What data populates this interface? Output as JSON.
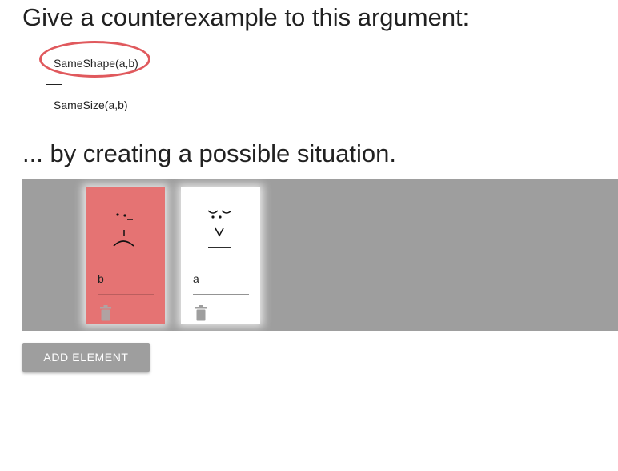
{
  "instructions": {
    "title": "Give a counterexample to this argument:",
    "subtitle": "... by creating a possible situation."
  },
  "argument": {
    "premise": "SameShape(a,b)",
    "conclusion": "SameSize(a,b)",
    "highlighted": "premise",
    "highlight_color": "#e0595d"
  },
  "world": {
    "background": "#9e9e9e",
    "elements": [
      {
        "name": "b",
        "face": "sad",
        "color": "#e57373",
        "delete_icon": "trash-icon"
      },
      {
        "name": "a",
        "face": "grumpy",
        "color": "#ffffff",
        "delete_icon": "trash-icon"
      }
    ]
  },
  "actions": {
    "add_element_label": "ADD ELEMENT"
  }
}
